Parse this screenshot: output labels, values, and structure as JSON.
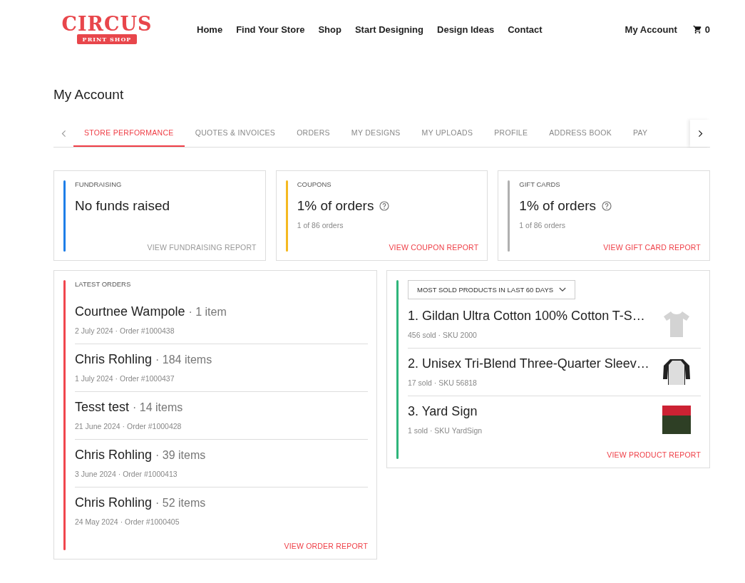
{
  "logo": {
    "name": "CIRCUS",
    "tagline": "PRINT SHOP"
  },
  "nav": [
    "Home",
    "Find Your Store",
    "Shop",
    "Start Designing",
    "Design Ideas",
    "Contact"
  ],
  "account_link": "My Account",
  "cart_count": "0",
  "page_title": "My Account",
  "tabs": [
    {
      "label": "STORE PERFORMANCE",
      "selected": true
    },
    {
      "label": "QUOTES & INVOICES",
      "selected": false
    },
    {
      "label": "ORDERS",
      "selected": false
    },
    {
      "label": "MY DESIGNS",
      "selected": false
    },
    {
      "label": "MY UPLOADS",
      "selected": false
    },
    {
      "label": "PROFILE",
      "selected": false
    },
    {
      "label": "ADDRESS BOOK",
      "selected": false
    },
    {
      "label": "PAY",
      "selected": false
    }
  ],
  "stats": [
    {
      "label": "FUNDRAISING",
      "value": "No funds raised",
      "help": false,
      "link": "VIEW FUNDRAISING REPORT",
      "link_disabled": true,
      "color": "#1e7ee8"
    },
    {
      "label": "COUPONS",
      "value": "1% of orders",
      "help": true,
      "detail": "1 of 86 orders",
      "link": "VIEW COUPON REPORT",
      "link_disabled": false,
      "color": "#f5b921"
    },
    {
      "label": "GIFT CARDS",
      "value": "1% of orders",
      "help": true,
      "detail": "1 of 86 orders",
      "link": "VIEW GIFT CARD REPORT",
      "link_disabled": false,
      "color": "#b0b0b0"
    }
  ],
  "latest_orders": {
    "title": "LATEST ORDERS",
    "color": "#f0464e",
    "link": "VIEW ORDER REPORT",
    "orders": [
      {
        "customer": "Courtnee Wampole",
        "items": "· 1 item",
        "meta": "2 July 2024 · Order #1000438"
      },
      {
        "customer": "Chris Rohling",
        "items": "· 184 items",
        "meta": "1 July 2024 · Order #1000437"
      },
      {
        "customer": "Tesst test",
        "items": "· 14 items",
        "meta": "21 June 2024 · Order #1000428"
      },
      {
        "customer": "Chris Rohling",
        "items": "· 39 items",
        "meta": "3 June 2024 · Order #1000413"
      },
      {
        "customer": "Chris Rohling",
        "items": "· 52 items",
        "meta": "24 May 2024 · Order #1000405"
      }
    ]
  },
  "products": {
    "filter": "MOST SOLD PRODUCTS IN LAST 60 DAYS",
    "color": "#2fb57a",
    "link": "VIEW PRODUCT REPORT",
    "items": [
      {
        "name": "1. Gildan Ultra Cotton 100% Cotton T-S…",
        "meta": "456 sold · SKU 2000",
        "kind": "tshirt"
      },
      {
        "name": "2. Unisex Tri-Blend Three-Quarter Sleev…",
        "meta": "17 sold · SKU 56818",
        "kind": "raglan"
      },
      {
        "name": "3. Yard Sign",
        "meta": "1 sold · SKU YardSign",
        "kind": "photo"
      }
    ]
  }
}
